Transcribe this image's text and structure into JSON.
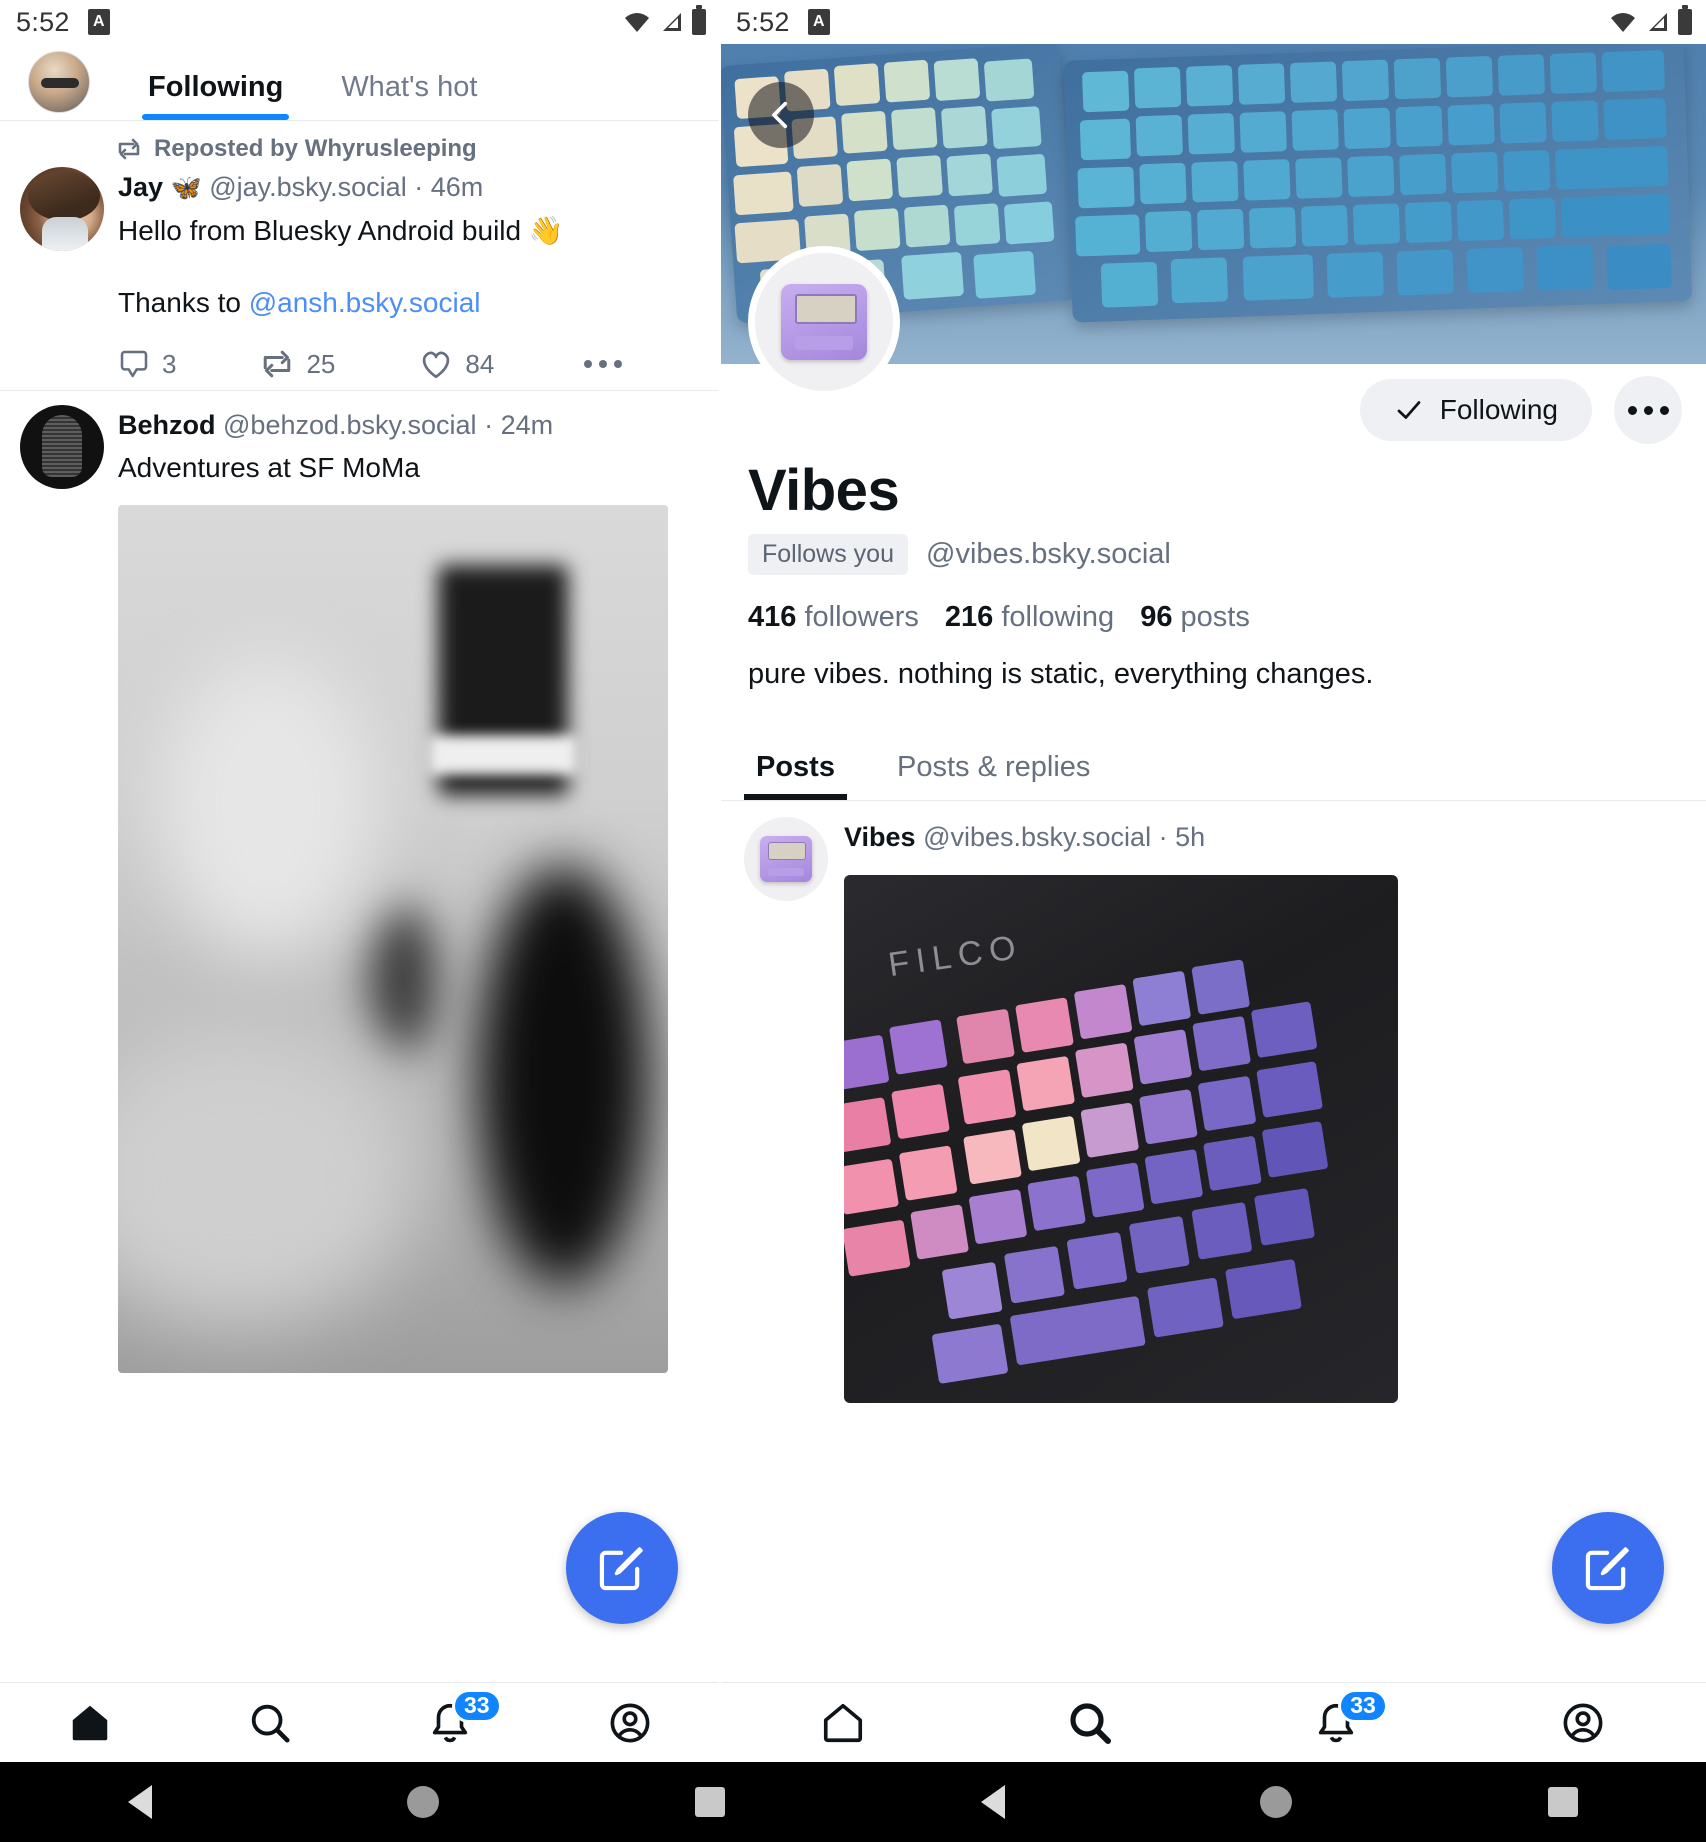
{
  "left": {
    "status": {
      "time": "5:52",
      "app_badge": "A"
    },
    "tabs": [
      {
        "label": "Following",
        "active": true
      },
      {
        "label": "What's hot",
        "active": false
      }
    ],
    "posts": [
      {
        "repost_label": "Reposted by Whyrusleeping",
        "display_name": "Jay",
        "name_emoji": "🦋",
        "handle": "@jay.bsky.social",
        "separator": "·",
        "time": "46m",
        "text": "Hello from Bluesky Android build 👋",
        "text2_prefix": "Thanks to ",
        "text2_link": "@ansh.bsky.social",
        "reply_count": "3",
        "repost_count": "25",
        "like_count": "84"
      },
      {
        "display_name": "Behzod",
        "handle": "@behzod.bsky.social",
        "separator": "·",
        "time": "24m",
        "text": "Adventures at SF MoMa"
      }
    ],
    "bottom_nav": [
      {
        "icon": "home-icon",
        "badge": ""
      },
      {
        "icon": "search-icon",
        "badge": ""
      },
      {
        "icon": "bell-icon",
        "badge": "33"
      },
      {
        "icon": "profile-icon",
        "badge": ""
      }
    ],
    "compose_label": "compose-icon"
  },
  "right": {
    "status": {
      "time": "5:52",
      "app_badge": "A"
    },
    "back_label": "back-icon",
    "follow_button": {
      "label": "Following",
      "icon": "check-icon"
    },
    "more_button": "more-options-icon",
    "profile": {
      "name": "Vibes",
      "follows_you_chip": "Follows you",
      "handle": "@vibes.bsky.social",
      "followers_count": "416",
      "followers_label": "followers",
      "following_count": "216",
      "following_label": "following",
      "posts_count": "96",
      "posts_label": "posts",
      "bio": "pure vibes. nothing is static, everything changes."
    },
    "tabs": [
      {
        "label": "Posts",
        "active": true
      },
      {
        "label": "Posts & replies",
        "active": false
      }
    ],
    "post": {
      "display_name": "Vibes",
      "handle": "@vibes.bsky.social",
      "separator": "·",
      "time": "5h",
      "image_brand": "FILCO"
    },
    "bottom_nav": [
      {
        "icon": "home-icon",
        "badge": ""
      },
      {
        "icon": "search-icon",
        "badge": ""
      },
      {
        "icon": "bell-icon",
        "badge": "33"
      },
      {
        "icon": "profile-icon",
        "badge": ""
      }
    ],
    "compose_label": "compose-icon"
  },
  "system_nav": {
    "back": "back-triangle-icon",
    "home": "home-circle-icon",
    "recents": "recents-square-icon"
  },
  "colors": {
    "accent": "#1185fe",
    "fab": "#3b6ff0",
    "muted": "#66707f",
    "text": "#0f1419"
  }
}
